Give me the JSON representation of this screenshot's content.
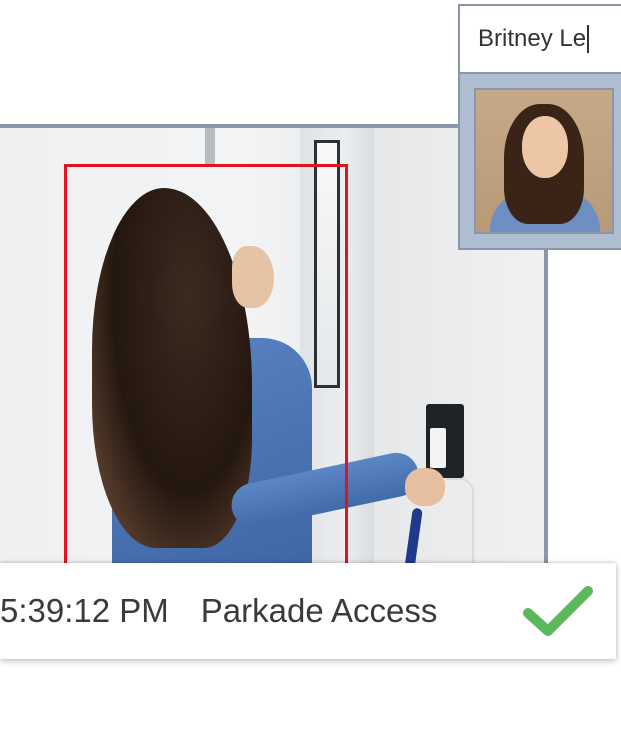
{
  "id_card": {
    "name": "Britney Le",
    "photo_alt": "Employee photo"
  },
  "access_event": {
    "time": "5:39:12 PM",
    "location": "Parkade Access",
    "status_icon": "check-icon",
    "status_color": "#5cb85c"
  },
  "colors": {
    "detection_box": "#e0141c",
    "frame_border": "#8a97a8"
  }
}
